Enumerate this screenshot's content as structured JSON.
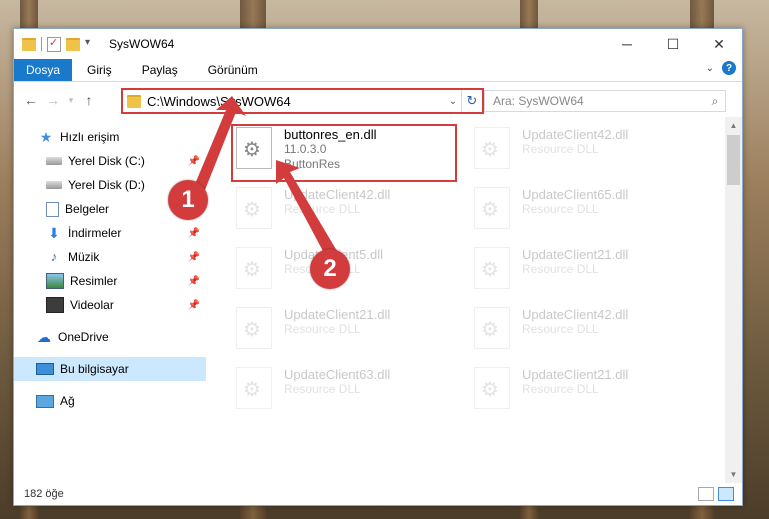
{
  "window": {
    "title": "SysWOW64",
    "buttons": {
      "minimize": "─",
      "maximize": "☐",
      "close": "✕"
    }
  },
  "ribbon": {
    "tabs": [
      "Dosya",
      "Giriş",
      "Paylaş",
      "Görünüm"
    ],
    "help": "?"
  },
  "navigation": {
    "back": "←",
    "forward": "→",
    "up": "↑",
    "address": "C:\\Windows\\SysWOW64",
    "refresh": "↻",
    "search_placeholder": "Ara: SysWOW64"
  },
  "sidebar": {
    "items": [
      {
        "label": "Hızlı erişim",
        "icon": "star-icon",
        "pinned": false
      },
      {
        "label": "Yerel Disk (C:)",
        "icon": "disk-icon",
        "pinned": true
      },
      {
        "label": "Yerel Disk (D:)",
        "icon": "disk-icon",
        "pinned": false
      },
      {
        "label": "Belgeler",
        "icon": "document-icon",
        "pinned": false
      },
      {
        "label": "İndirmeler",
        "icon": "download-icon",
        "pinned": true
      },
      {
        "label": "Müzik",
        "icon": "music-icon",
        "pinned": true
      },
      {
        "label": "Resimler",
        "icon": "pictures-icon",
        "pinned": true
      },
      {
        "label": "Videolar",
        "icon": "videos-icon",
        "pinned": true
      },
      {
        "label": "OneDrive",
        "icon": "onedrive-icon",
        "pinned": false
      },
      {
        "label": "Bu bilgisayar",
        "icon": "this-pc-icon",
        "pinned": false,
        "selected": true
      },
      {
        "label": "Ağ",
        "icon": "network-icon",
        "pinned": false
      }
    ]
  },
  "files": [
    {
      "name": "buttonres_en.dll",
      "line2": "11.0.3.0",
      "line3": "ButtonRes",
      "highlighted": true
    },
    {
      "name": "UpdateClient42.dll",
      "line2": "Resource DLL"
    },
    {
      "name": "UpdateClient42.dll",
      "line2": "Resource DLL"
    },
    {
      "name": "UpdateClient65.dll",
      "line2": "Resource DLL"
    },
    {
      "name": "UpdateClient5.dll",
      "line2": "Resource DLL"
    },
    {
      "name": "UpdateClient21.dll",
      "line2": "Resource DLL"
    },
    {
      "name": "UpdateClient21.dll",
      "line2": "Resource DLL"
    },
    {
      "name": "UpdateClient42.dll",
      "line2": "Resource DLL"
    },
    {
      "name": "UpdateClient63.dll",
      "line2": "Resource DLL"
    },
    {
      "name": "UpdateClient21.dll",
      "line2": "Resource DLL"
    }
  ],
  "status": {
    "item_count": "182 öğe"
  },
  "callouts": [
    "1",
    "2"
  ]
}
